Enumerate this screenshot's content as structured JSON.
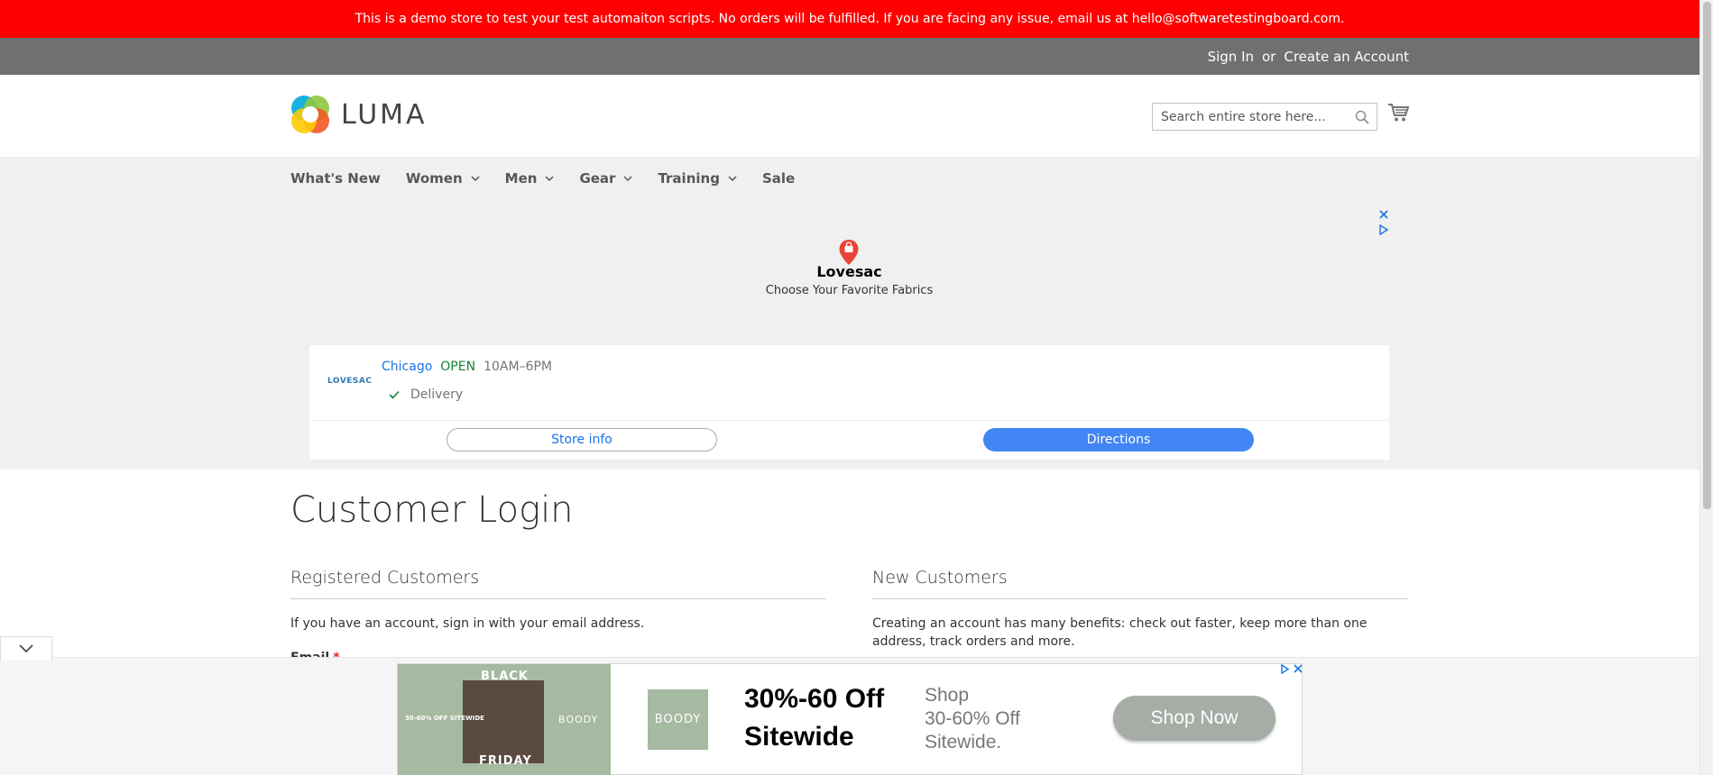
{
  "notice": {
    "text": "This is a demo store to test your test automaiton scripts. No orders will be fulfilled. If you are facing any issue, email us at hello@softwaretestingboard.com."
  },
  "toplinks": {
    "sign_in": "Sign In",
    "or": "or",
    "create_account": "Create an Account"
  },
  "header": {
    "logo_text": "LUMA",
    "search_placeholder": "Search entire store here...",
    "icons": {
      "search": "search-icon",
      "cart": "cart-icon"
    }
  },
  "nav": {
    "items": [
      {
        "label": "What's New",
        "has_dropdown": false
      },
      {
        "label": "Women",
        "has_dropdown": true
      },
      {
        "label": "Men",
        "has_dropdown": true
      },
      {
        "label": "Gear",
        "has_dropdown": true
      },
      {
        "label": "Training",
        "has_dropdown": true
      },
      {
        "label": "Sale",
        "has_dropdown": false
      }
    ]
  },
  "map_ad": {
    "store_name": "Lovesac",
    "tagline": "Choose Your Favorite Fabrics",
    "brand_mini": "LOVESAC",
    "city": "Chicago",
    "status": "OPEN",
    "hours": "10AM–6PM",
    "delivery": "Delivery",
    "store_info_label": "Store info",
    "directions_label": "Directions",
    "colors": {
      "link": "#1a73e8",
      "open": "#188038",
      "directions_bg": "#4285f4"
    }
  },
  "main": {
    "page_title": "Customer Login",
    "registered": {
      "title": "Registered Customers",
      "text": "If you have an account, sign in with your email address.",
      "email_label": "Email",
      "required_marker": "*"
    },
    "new_customers": {
      "title": "New Customers",
      "text": "Creating an account has many benefits: check out faster, keep more than one address, track orders and more."
    }
  },
  "bottom_ad": {
    "thumb_top": "BLACK",
    "thumb_bottom": "FRIDAY",
    "thumb_pct": "30-60% OFF SITEWIDE",
    "thumb_brand": "BOODY",
    "brand_box": "BOODY",
    "headline_1": "30%-60 Off",
    "headline_2": "Sitewide",
    "sub_1": "Shop",
    "sub_2": "30-60% Off",
    "sub_3": "Sitewide.",
    "cta": "Shop Now"
  },
  "colors": {
    "notice_bg": "#ff0000",
    "toplinks_bg": "#6e716e",
    "nav_bg": "#f0f0f0",
    "ad_green": "#a6b9a1"
  }
}
